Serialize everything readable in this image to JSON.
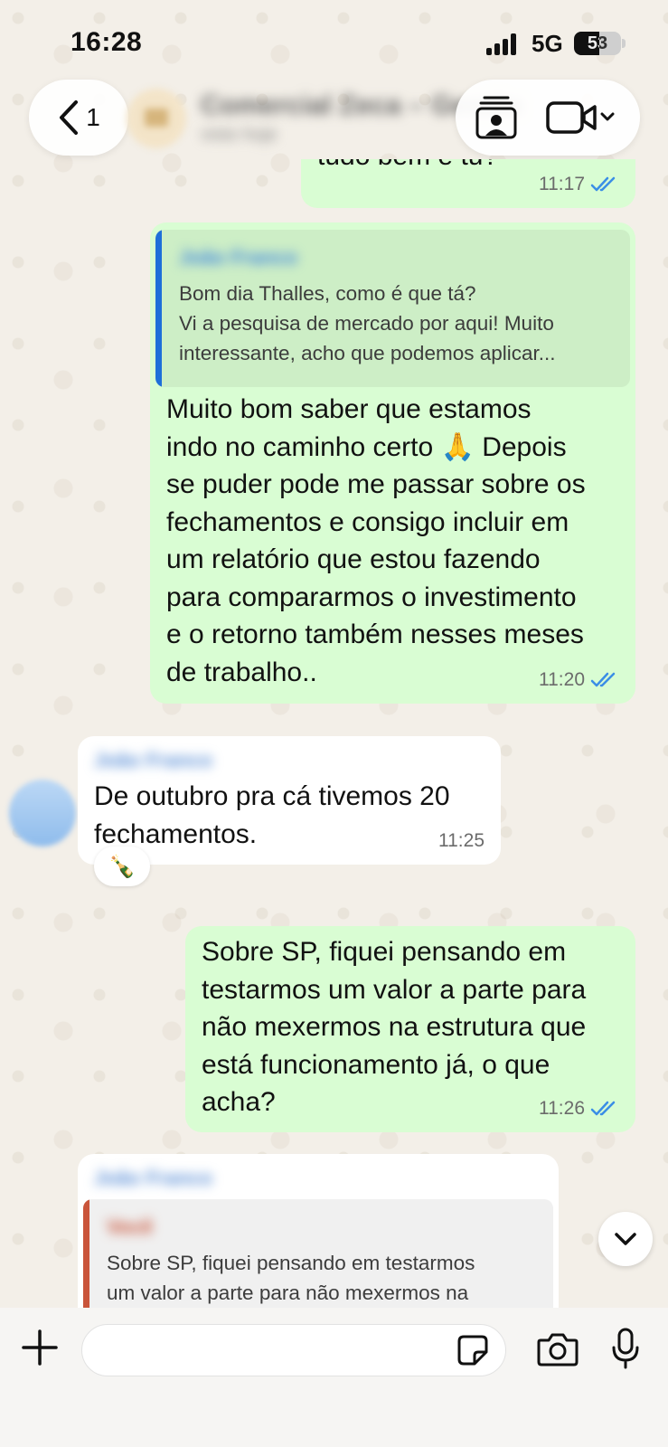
{
  "status_bar": {
    "time": "16:28",
    "network": "5G",
    "battery": "53",
    "battery_level": 0.53
  },
  "header": {
    "back_count": "1",
    "contact_name": "Comercial Zeca – Gestão",
    "contact_status": "visto hoje"
  },
  "messages": [
    {
      "direction": "out",
      "text": "tudo bem e tu?",
      "time": "11:17",
      "status": "read"
    },
    {
      "direction": "out",
      "quote": {
        "author": "João Franco",
        "text": "Bom dia Thalles, como é que tá?\nVi a pesquisa de mercado por aqui! Muito interessante, acho que podemos aplicar..."
      },
      "text": "Muito bom saber que estamos\nindo no caminho certo 🙏 Depois\nse puder pode me passar sobre os\nfechamentos e consigo incluir em\num relatório que estou fazendo\npara compararmos o investimento\ne o retorno também nesses meses\nde trabalho..",
      "time": "11:20",
      "status": "read"
    },
    {
      "direction": "in",
      "sender": "João Franco",
      "text": "De outubro pra cá tivemos 20\nfechamentos.",
      "time": "11:25",
      "reaction": "🍾"
    },
    {
      "direction": "out",
      "text": "Sobre SP, fiquei pensando em\ntestarmos um valor a parte para\nnão mexermos na estrutura que\nestá funcionamento já, o que\nacha?",
      "time": "11:26",
      "status": "read"
    },
    {
      "direction": "in",
      "sender": "João Franco",
      "quote": {
        "author": "Você",
        "text": "Sobre SP, fiquei pensando em testarmos\num valor a parte para não mexermos na"
      }
    }
  ],
  "input": {
    "value": "",
    "placeholder": ""
  },
  "icons": {
    "back": "chevron-left-icon",
    "contact_card": "contact-card-icon",
    "video": "video-camera-icon",
    "scroll": "chevron-down-icon",
    "plus": "plus-icon",
    "sticker": "sticker-icon",
    "camera": "camera-icon",
    "mic": "microphone-icon",
    "read_receipt": "double-check-icon"
  },
  "colors": {
    "outgoing_bubble": "#d9fdd3",
    "incoming_bubble": "#ffffff",
    "read_ticks": "#3b8ee6",
    "quote_bar_blue": "#1e6fd9",
    "quote_bar_red": "#c9543a",
    "wallpaper": "#f3efe8"
  }
}
